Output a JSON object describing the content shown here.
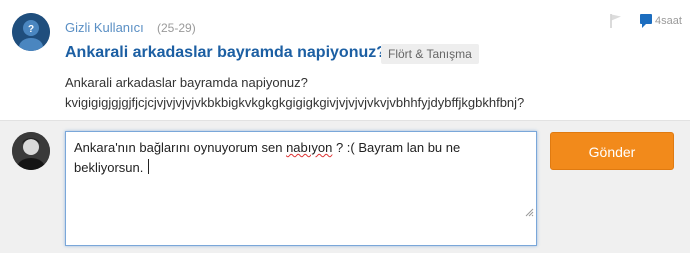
{
  "question": {
    "username": "Gizli Kullanıcı",
    "age": "(25-29)",
    "title": "Ankarali arkadaslar bayramda napiyonuz?",
    "category": "Flört & Tanışma",
    "body_line1": "Ankarali arkadaslar bayramda napiyonuz?",
    "body_line2": "kvigigigjgjgjfjcjcjvjvjvjvjvkbkbigkvkgkgkgigigkgivjvjvjvjvkvjvbhhfyjdybffjkgbkhfbnj?",
    "time": "4saat"
  },
  "reply": {
    "text_before": "Ankara'nın bağlarını oynuyorum sen ",
    "text_misspelled": "nabıyon",
    "text_after": " ? :( Bayram lan bu ne\nbekliyorsun. ",
    "send_label": "Gönder"
  },
  "colors": {
    "accent": "#1c5fa3",
    "send_button": "#f28a1b",
    "username": "#5a8fc4"
  }
}
